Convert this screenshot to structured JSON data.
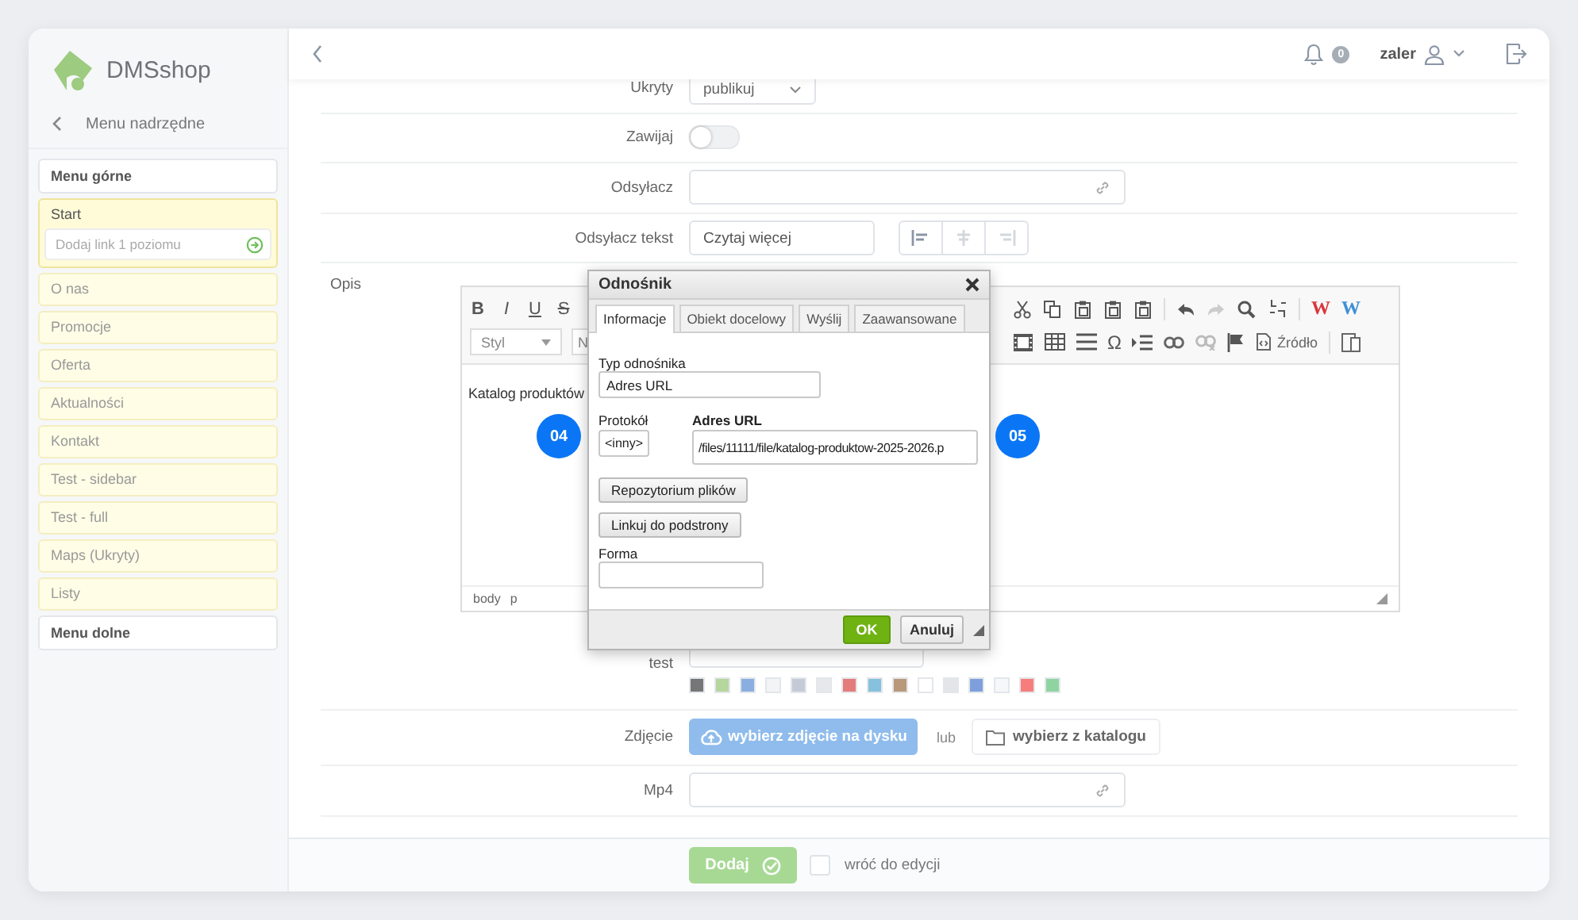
{
  "sidebar": {
    "logo_text": "DMSshop",
    "back_label": "Menu nadrzędne",
    "sections": [
      {
        "label": "Menu górne",
        "items": [
          {
            "label": "Start",
            "expanded": true,
            "add_placeholder": "Dodaj link 1 poziomu"
          },
          {
            "label": "O nas",
            "expanded": false
          },
          {
            "label": "Promocje",
            "expanded": false
          },
          {
            "label": "Oferta",
            "expanded": false
          },
          {
            "label": "Aktualności",
            "expanded": false
          },
          {
            "label": "Kontakt",
            "expanded": false
          },
          {
            "label": "Test - sidebar",
            "expanded": false
          },
          {
            "label": "Test - full",
            "expanded": false
          },
          {
            "label": "Maps (Ukryty)",
            "expanded": false
          },
          {
            "label": "Listy",
            "expanded": false
          }
        ]
      },
      {
        "label": "Menu dolne"
      }
    ]
  },
  "header": {
    "notifications": "0",
    "user": "zaler"
  },
  "form": {
    "visibility": {
      "label": "Ukryty",
      "value": "publikuj"
    },
    "wrap": {
      "label": "Zawijaj",
      "on": false
    },
    "link": {
      "label": "Odsyłacz"
    },
    "link_text": {
      "label": "Odsyłacz tekst",
      "value": "Czytaj więcej",
      "alignment": [
        {
          "selected": true
        },
        {
          "selected": false
        },
        {
          "selected": false
        }
      ]
    },
    "description": {
      "label": "Opis",
      "format_buttons": [
        "B",
        "I",
        "U",
        "S"
      ],
      "word_buttons": [
        {
          "text": "W",
          "color": "#d9373c"
        },
        {
          "text": "W",
          "color": "#3f8fd8"
        }
      ],
      "style_select": "Styl",
      "format_select": "N",
      "omega": "Ω",
      "source_button": "Źródło",
      "content": "Katalog produktów",
      "path": [
        "body",
        "p"
      ]
    },
    "color": {
      "label": "test",
      "swatches": [
        {
          "color": "#767676"
        },
        {
          "color": "#b5d69c"
        },
        {
          "color": "#8aaee0"
        },
        {
          "color": "#f3f4f6"
        },
        {
          "color": "#c5cbd6"
        },
        {
          "color": "#e6e8ec"
        },
        {
          "color": "#e47c7c"
        },
        {
          "color": "#86c1de"
        },
        {
          "color": "#b8997a"
        },
        {
          "color": "#ffffff"
        },
        {
          "color": "#e3e5e8"
        },
        {
          "color": "#7f9fdc"
        },
        {
          "color": "#f6f7f9"
        },
        {
          "color": "#f77d7d"
        },
        {
          "color": "#8fd4a0"
        }
      ]
    },
    "photo": {
      "label": "Zdjęcie",
      "upload_button": "wybierz zdjęcie na dysku",
      "or": "lub",
      "catalog_button": "wybierz z katalogu"
    },
    "mp4": {
      "label": "Mp4"
    }
  },
  "footer": {
    "submit": "Dodaj",
    "return_checkbox": {
      "label": "wróć do edycji",
      "checked": false
    }
  },
  "dialog": {
    "title": "Odnośnik",
    "tabs": [
      {
        "label": "Informacje",
        "selected": true
      },
      {
        "label": "Obiekt docelowy",
        "selected": false
      },
      {
        "label": "Wyślij",
        "selected": false
      },
      {
        "label": "Zaawansowane",
        "selected": false
      }
    ],
    "link_type": {
      "label": "Typ odnośnika",
      "value": "Adres URL"
    },
    "protocol": {
      "label": "Protokół",
      "value": "<inny>"
    },
    "url": {
      "label": "Adres URL",
      "value": "/files/11111/file/katalog-produktow-2025-2026.p"
    },
    "buttons": [
      "Repozytorium plików",
      "Linkuj do podstrony"
    ],
    "form_field": {
      "label": "Forma"
    },
    "ok": "OK",
    "cancel": "Anuluj"
  },
  "markers": [
    "04",
    "05"
  ]
}
